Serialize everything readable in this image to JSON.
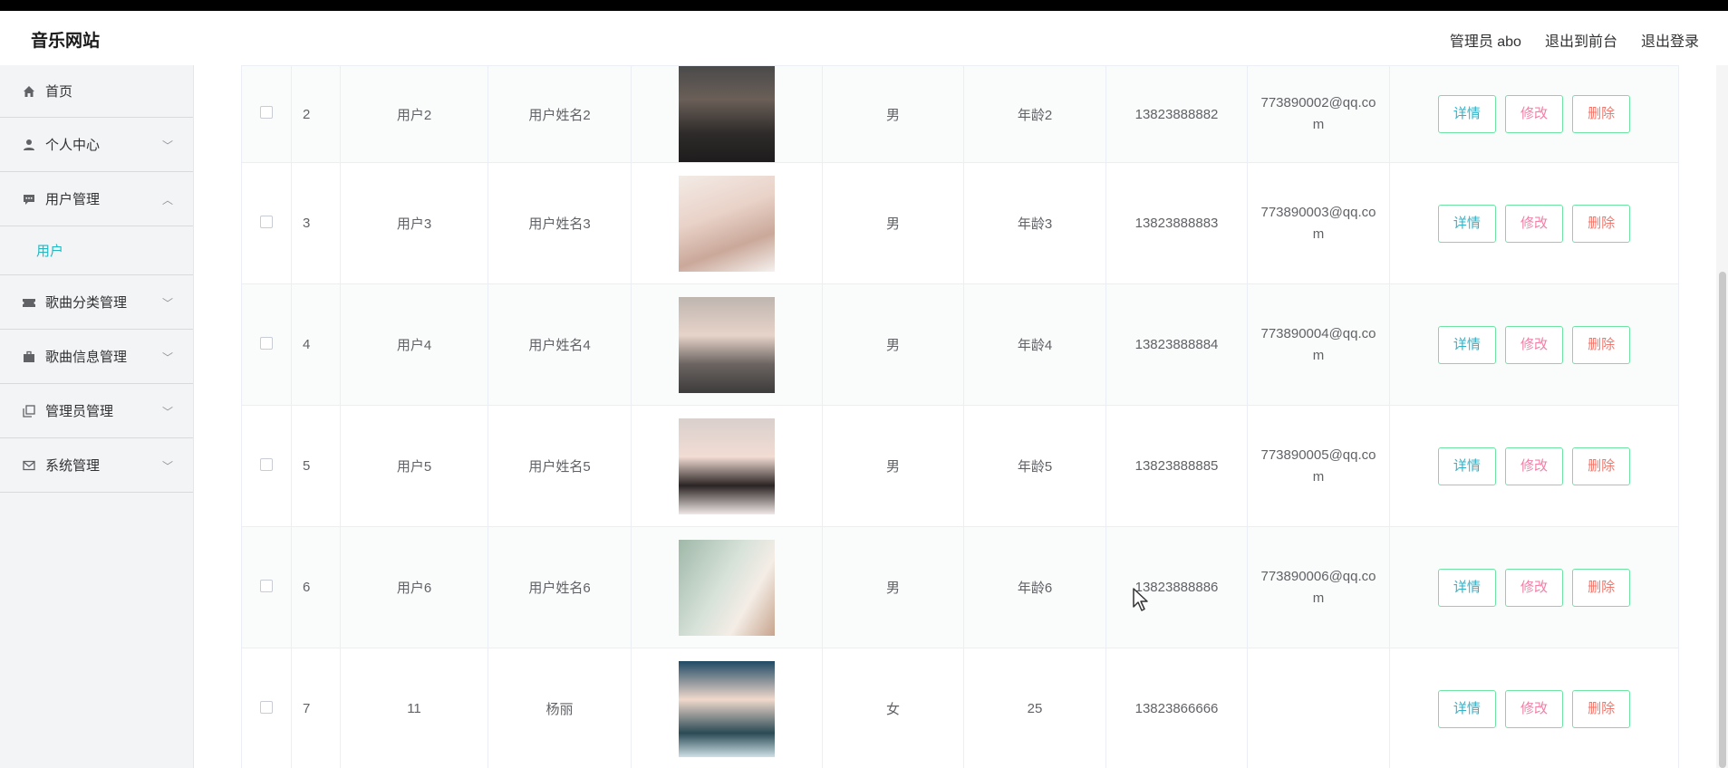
{
  "brand": "音乐网站",
  "header": {
    "admin_label": "管理员 abo",
    "exit_front": "退出到前台",
    "logout": "退出登录"
  },
  "sidebar": {
    "items": [
      {
        "label": "首页",
        "icon": "home-icon"
      },
      {
        "label": "个人中心",
        "icon": "user-icon"
      },
      {
        "label": "用户管理",
        "icon": "chat-icon"
      },
      {
        "label": "用户",
        "icon": ""
      },
      {
        "label": "歌曲分类管理",
        "icon": "ticket-icon"
      },
      {
        "label": "歌曲信息管理",
        "icon": "briefcase-icon"
      },
      {
        "label": "管理员管理",
        "icon": "copy-icon"
      },
      {
        "label": "系统管理",
        "icon": "mail-icon"
      }
    ]
  },
  "actions": {
    "detail": "详情",
    "edit": "修改",
    "delete": "删除"
  },
  "rows": [
    {
      "num": "2",
      "account": "用户2",
      "name": "用户姓名2",
      "gender": "男",
      "age": "年龄2",
      "phone": "13823888882",
      "email": "773890002@qq.com"
    },
    {
      "num": "3",
      "account": "用户3",
      "name": "用户姓名3",
      "gender": "男",
      "age": "年龄3",
      "phone": "13823888883",
      "email": "773890003@qq.com"
    },
    {
      "num": "4",
      "account": "用户4",
      "name": "用户姓名4",
      "gender": "男",
      "age": "年龄4",
      "phone": "13823888884",
      "email": "773890004@qq.com"
    },
    {
      "num": "5",
      "account": "用户5",
      "name": "用户姓名5",
      "gender": "男",
      "age": "年龄5",
      "phone": "13823888885",
      "email": "773890005@qq.com"
    },
    {
      "num": "6",
      "account": "用户6",
      "name": "用户姓名6",
      "gender": "男",
      "age": "年龄6",
      "phone": "13823888886",
      "email": "773890006@qq.com"
    },
    {
      "num": "7",
      "account": "11",
      "name": "杨丽",
      "gender": "女",
      "age": "25",
      "phone": "13823866666",
      "email": ""
    }
  ],
  "colors": {
    "accent": "#23b7c2",
    "button_border": "#6ee3a3",
    "edit": "#f27fa6",
    "delete": "#f2766b"
  }
}
